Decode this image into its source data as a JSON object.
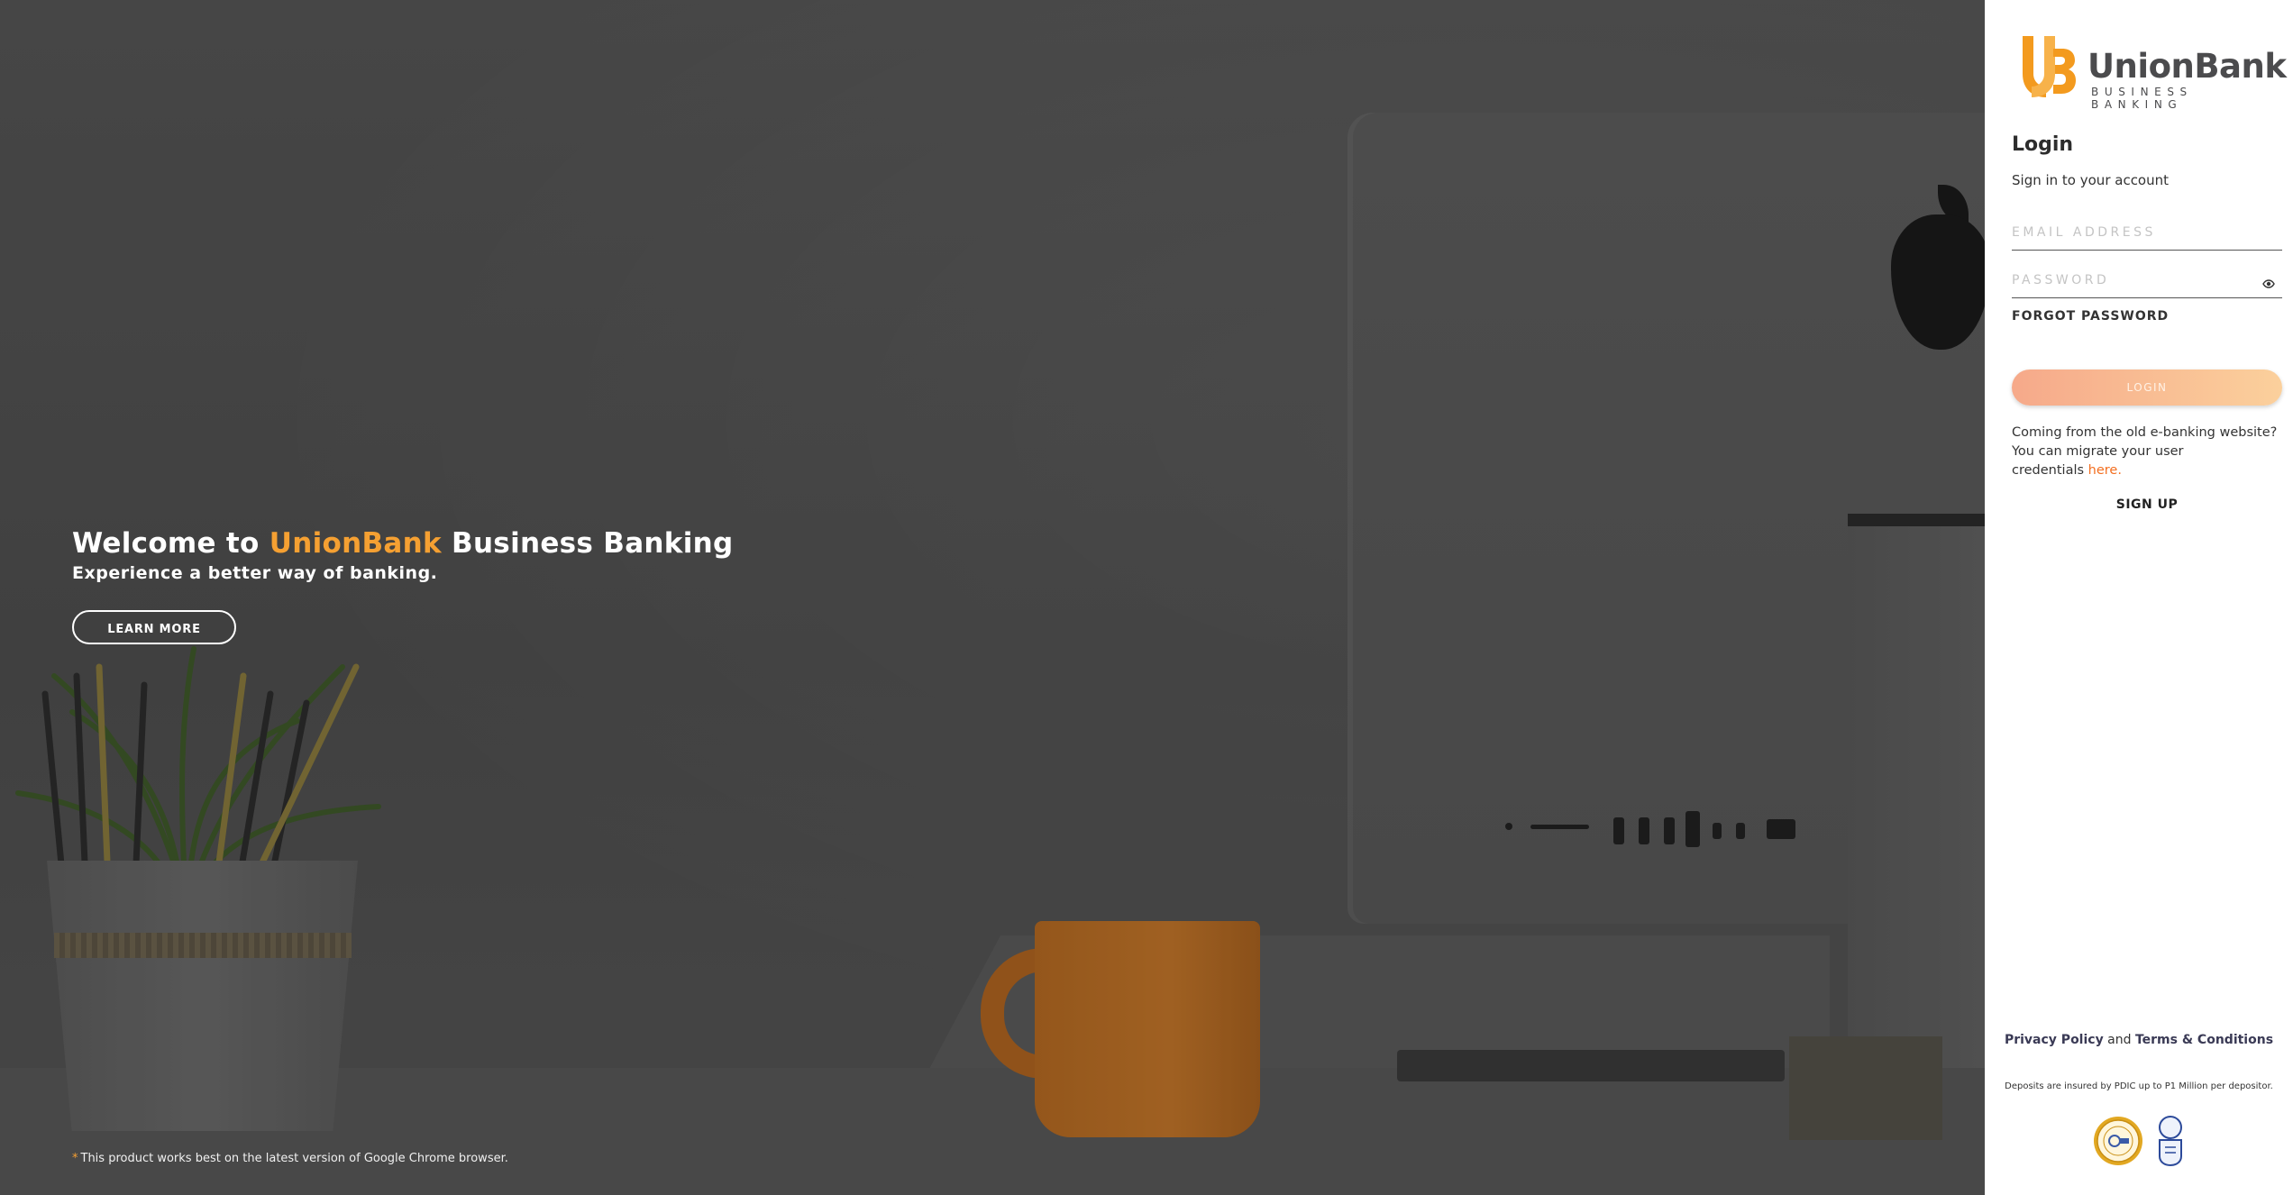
{
  "hero": {
    "title_prefix": "Welcome to ",
    "title_brand": "UnionBank",
    "title_suffix": " Business Banking",
    "subtitle": "Experience a better way of banking.",
    "learn_more_label": "LEARN MORE",
    "browser_note_marker": "*",
    "browser_note": "This product works best on the latest version of Google Chrome browser.",
    "brand_color": "#f5a032"
  },
  "logo": {
    "name": "UnionBank",
    "tagline": "BUSINESS BANKING",
    "mark_icon": "ub-logo-mark",
    "color": "#f39a1e"
  },
  "login": {
    "title": "Login",
    "subtitle": "Sign in to your account",
    "email_placeholder": "EMAIL ADDRESS",
    "email_value": "",
    "password_placeholder": "PASSWORD",
    "password_value": "",
    "password_toggle_icon": "eye-icon",
    "forgot_label": "FORGOT PASSWORD",
    "button_label": "LOGIN",
    "migrate_line1": "Coming from the old e-banking website?",
    "migrate_line2": "You can migrate your user",
    "migrate_line3": "credentials",
    "migrate_link": "here",
    "migrate_end": ".",
    "signup_label": "SIGN UP",
    "accent_color": "#f36f21"
  },
  "footer": {
    "privacy_label": "Privacy Policy",
    "and_text": " and ",
    "terms_label": "Terms & Conditions",
    "pdic_note": "Deposits are insured by PDIC up to P1 Million per depositor.",
    "seal_icons": [
      "pdic-seal-icon",
      "bsp-seal-icon"
    ]
  }
}
